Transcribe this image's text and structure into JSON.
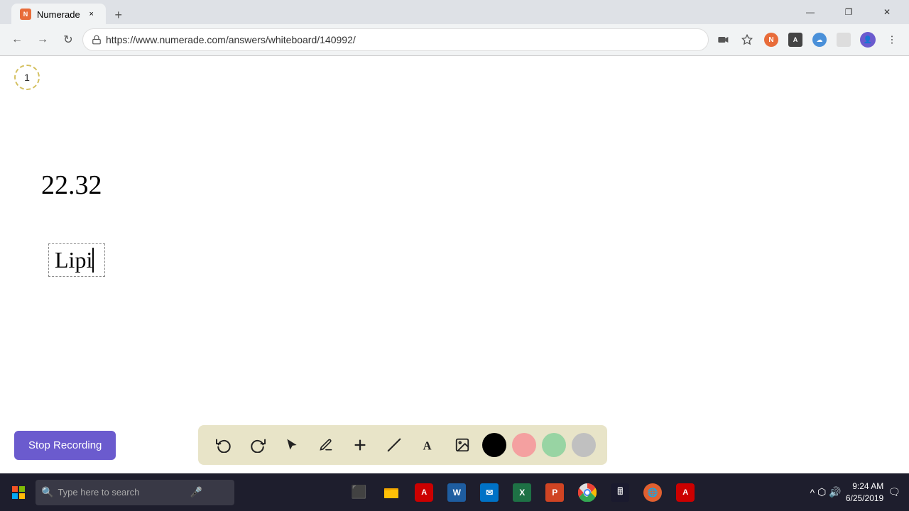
{
  "browser": {
    "tab": {
      "title": "Numerade",
      "favicon_color": "#e86c3a",
      "close_label": "×"
    },
    "new_tab_label": "+",
    "address": "https://www.numerade.com/answers/whiteboard/140992/",
    "nav": {
      "back_label": "←",
      "forward_label": "→",
      "reload_label": "↻"
    },
    "window_controls": {
      "minimize": "—",
      "maximize": "❐",
      "close": "✕"
    }
  },
  "whiteboard": {
    "page_number": "1",
    "main_text": "22.32",
    "text_box_content": "Lipi"
  },
  "toolbar": {
    "undo_label": "↺",
    "redo_label": "↻",
    "select_label": "▲",
    "pencil_label": "✏",
    "plus_label": "+",
    "line_label": "/",
    "text_label": "A",
    "image_label": "🖼",
    "color_black": "#000000",
    "color_pink": "#f4a0a0",
    "color_green": "#98d4a3",
    "color_gray": "#c0c0c0"
  },
  "stop_recording": {
    "label": "Stop Recording"
  },
  "taskbar": {
    "search_placeholder": "Type here to search",
    "time": "9:24 AM",
    "date": "6/25/2019",
    "apps": [
      "⊞",
      "⬜",
      "📁",
      "🔴",
      "W",
      "✉",
      "X",
      "P",
      "G",
      "🖩",
      "🌐",
      "🖥"
    ]
  }
}
